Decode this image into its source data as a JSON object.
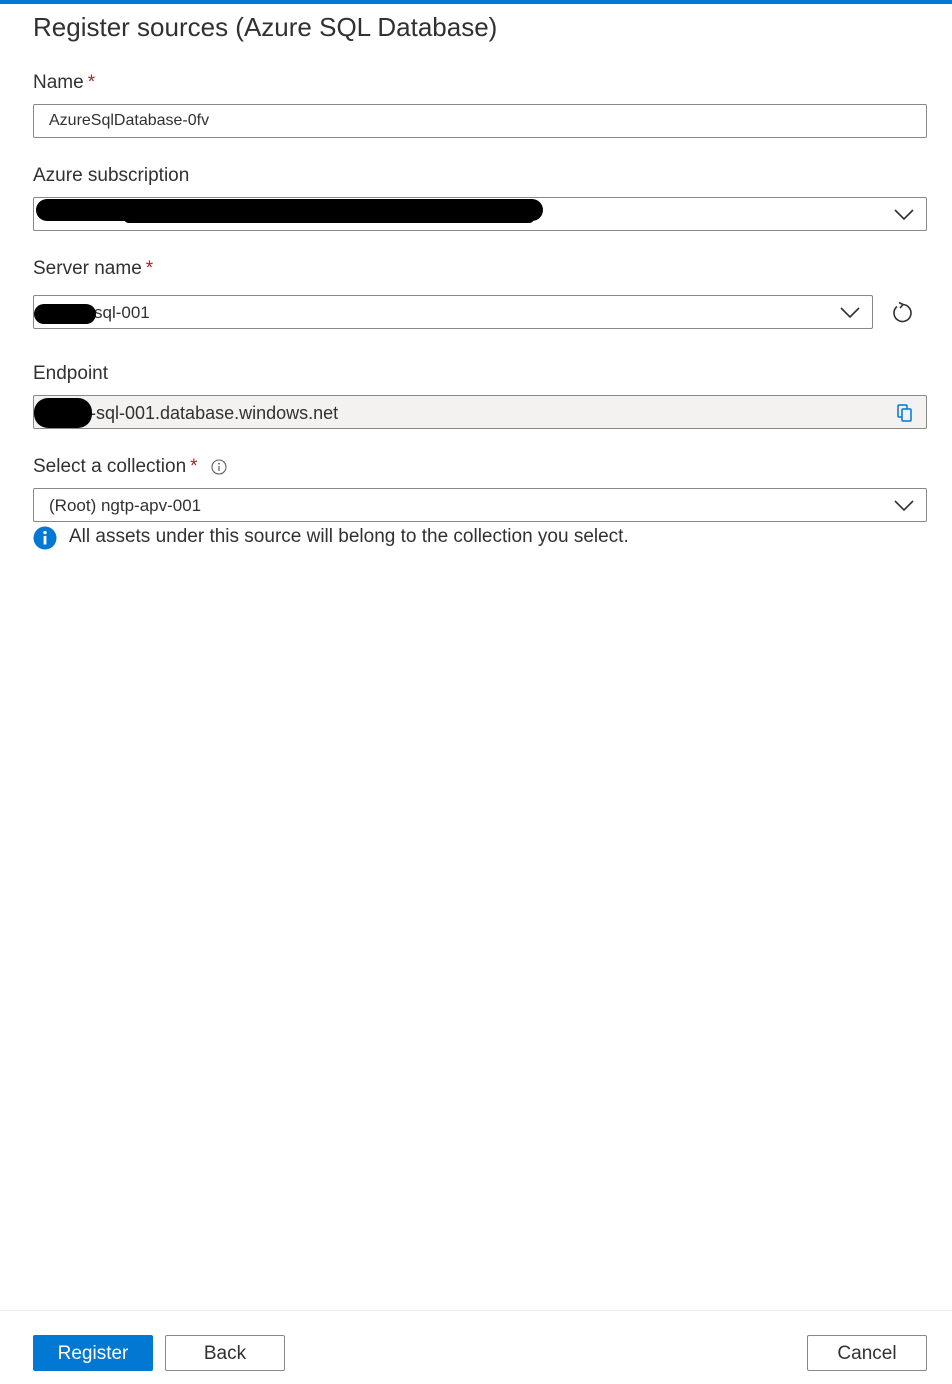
{
  "panel": {
    "title": "Register sources (Azure SQL Database)"
  },
  "form": {
    "name": {
      "label": "Name",
      "required_mark": "*",
      "value": "AzureSqlDatabase-0fv"
    },
    "subscription": {
      "label": "Azure subscription",
      "value": ""
    },
    "server_name": {
      "label": "Server name",
      "required_mark": "*",
      "value": "sql-001"
    },
    "endpoint": {
      "label": "Endpoint",
      "value": "-sql-001.database.windows.net"
    },
    "collection": {
      "label": "Select a collection",
      "required_mark": "*",
      "value": "(Root) ngtp-apv-001",
      "info_message": "All assets under this source will belong to the collection you select."
    }
  },
  "footer": {
    "register_label": "Register",
    "back_label": "Back",
    "cancel_label": "Cancel"
  },
  "icons": {
    "dropdown": "chevron-down-icon",
    "refresh": "refresh-icon",
    "copy": "copy-icon",
    "info": "info-icon"
  },
  "colors": {
    "accent": "#0078d4",
    "required": "#a4262c",
    "text": "#323130",
    "border": "#8a8886",
    "disabled_bg": "#f3f2f1"
  }
}
